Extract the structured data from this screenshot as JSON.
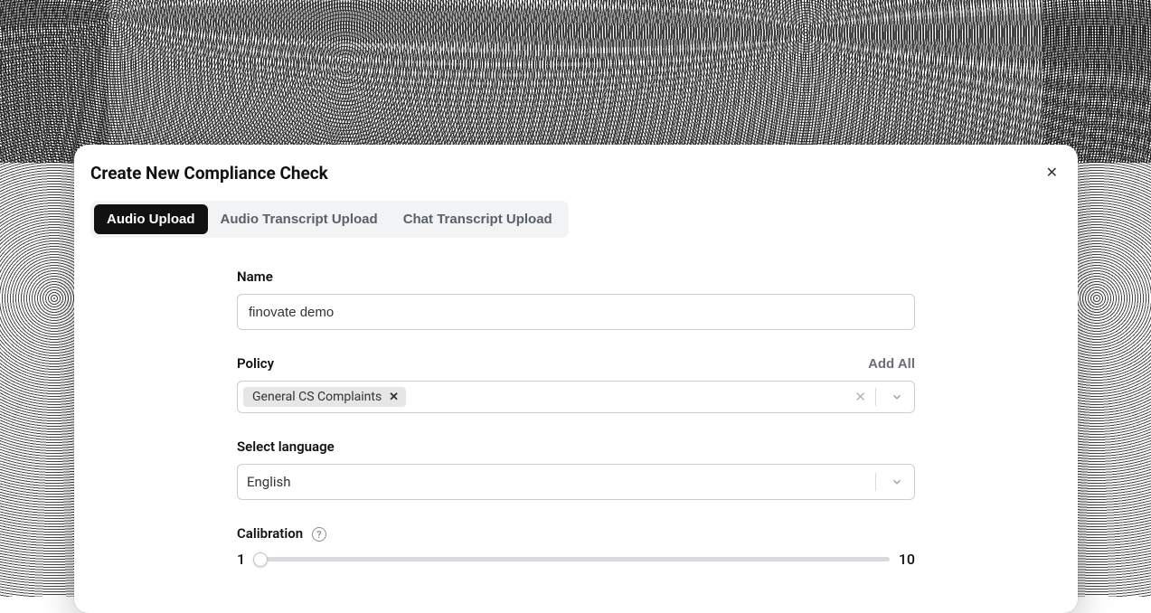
{
  "modal": {
    "title": "Create New Compliance Check"
  },
  "tabs": [
    {
      "label": "Audio Upload",
      "active": true
    },
    {
      "label": "Audio Transcript Upload",
      "active": false
    },
    {
      "label": "Chat Transcript Upload",
      "active": false
    }
  ],
  "fields": {
    "name": {
      "label": "Name",
      "value": "finovate demo"
    },
    "policy": {
      "label": "Policy",
      "add_all_label": "Add All",
      "tags": [
        "General CS Complaints"
      ]
    },
    "language": {
      "label": "Select language",
      "value": "English"
    },
    "calibration": {
      "label": "Calibration",
      "min": "1",
      "max": "10",
      "value": 1
    }
  }
}
